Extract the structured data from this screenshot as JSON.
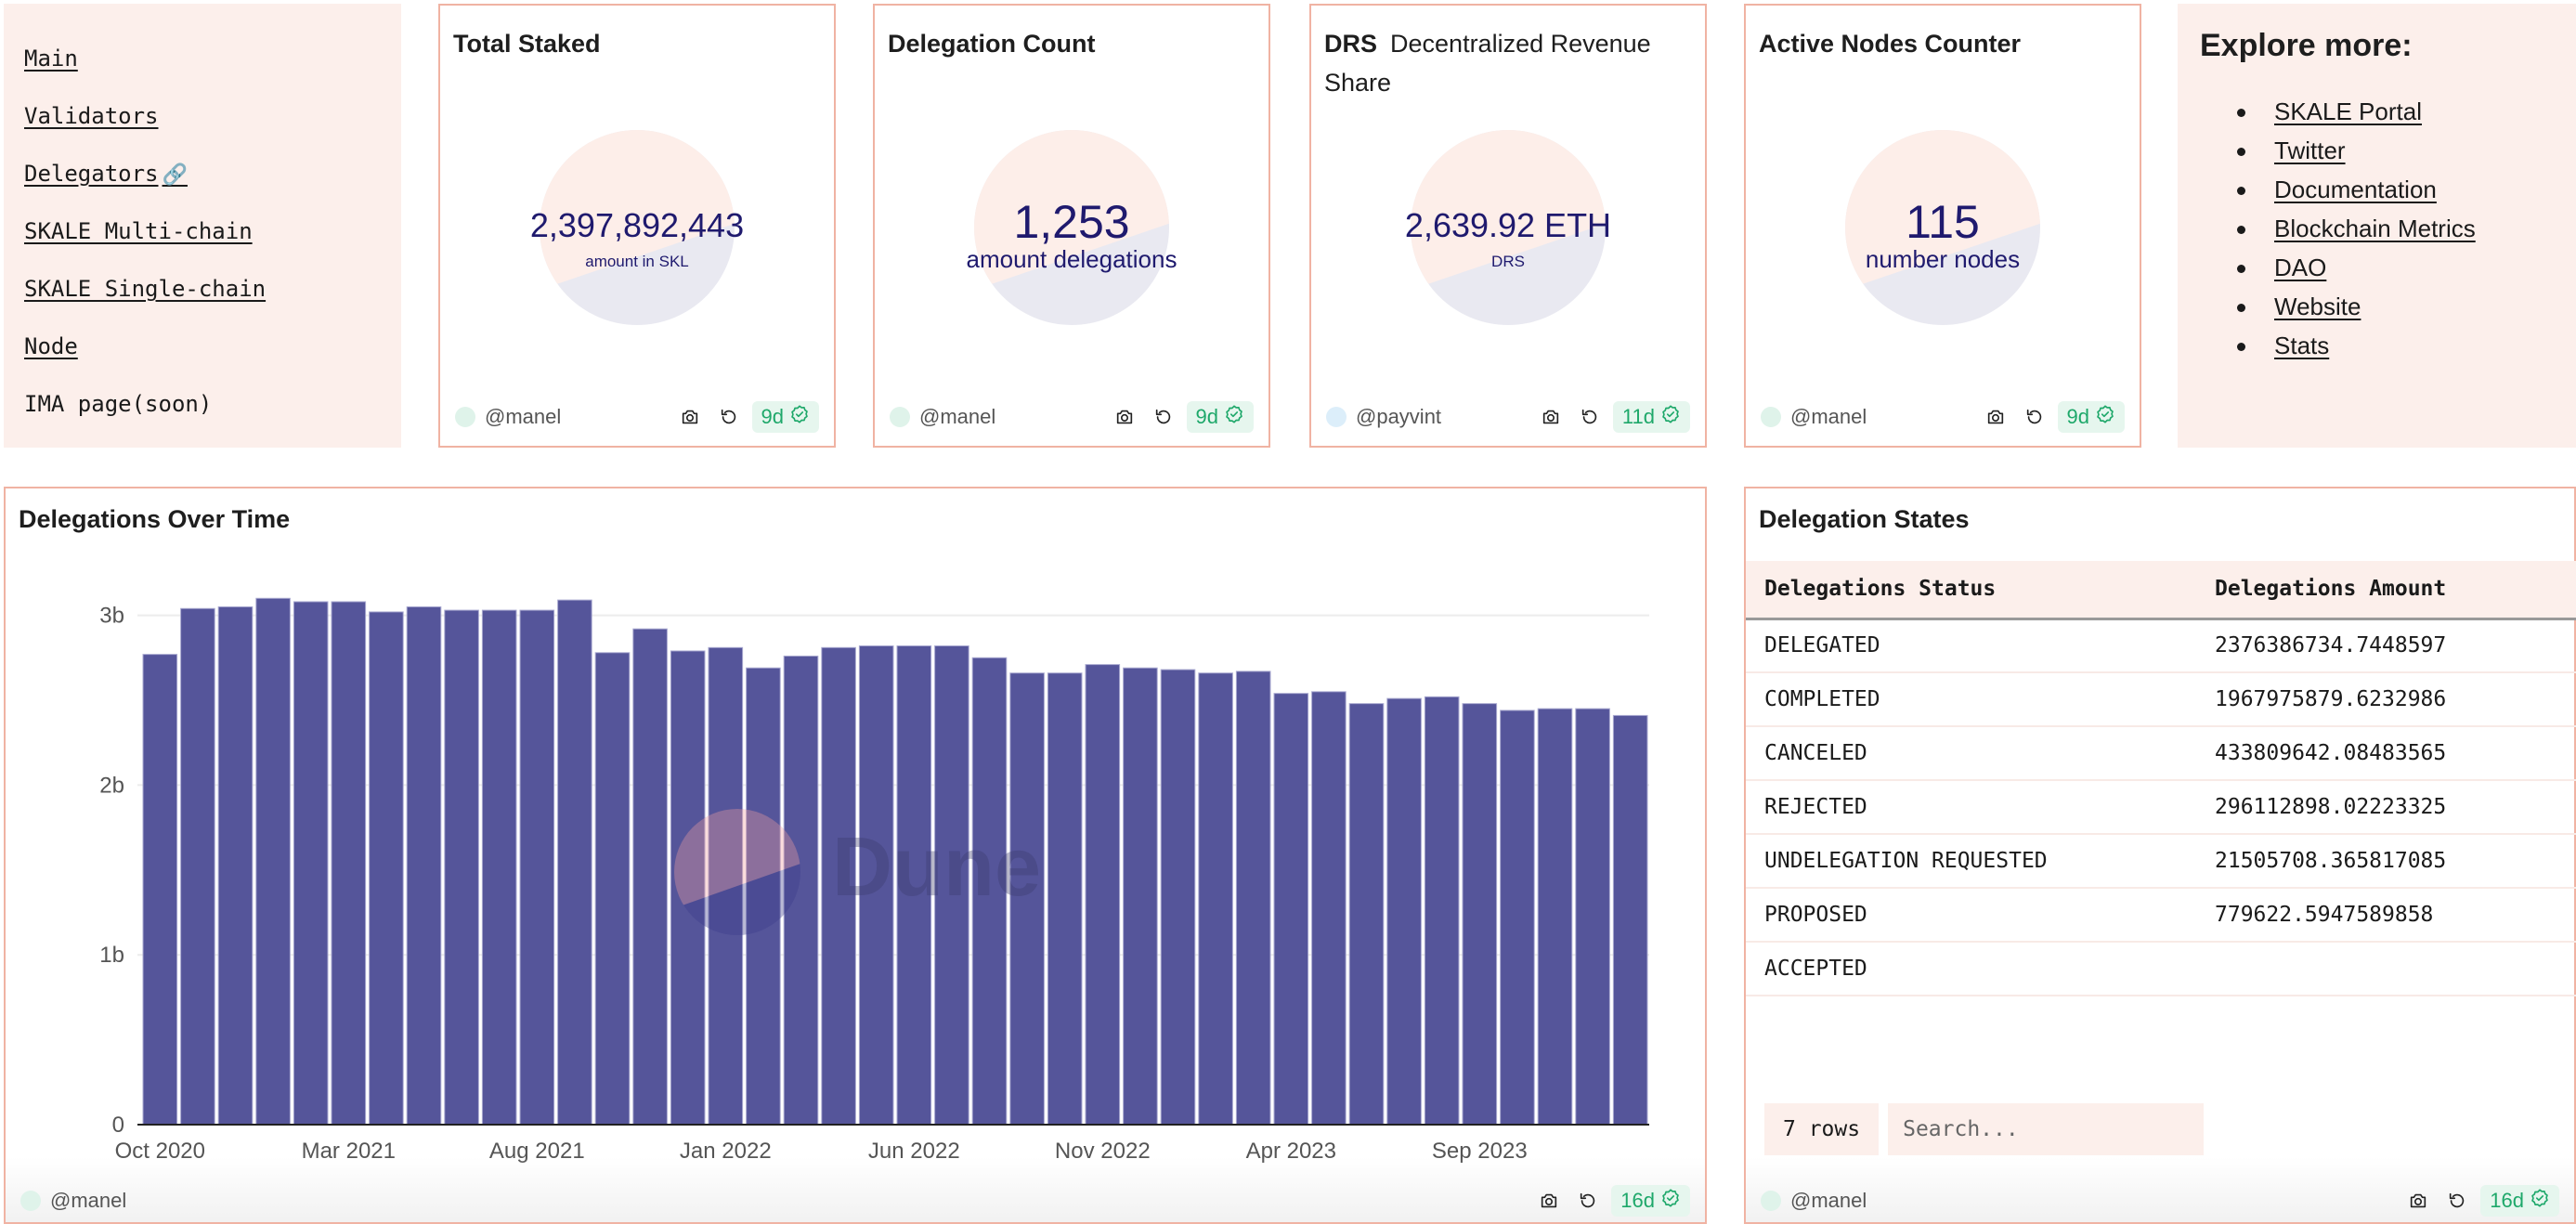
{
  "nav": {
    "items": [
      {
        "label": "Main",
        "link": true
      },
      {
        "label": "Validators",
        "link": true
      },
      {
        "label": "Delegators",
        "link": true,
        "emoji": "🔗"
      },
      {
        "label": "SKALE Multi-chain",
        "link": true
      },
      {
        "label": "SKALE Single-chain",
        "link": true
      },
      {
        "label": "Node",
        "link": true
      },
      {
        "label": "IMA page(soon)",
        "link": false
      }
    ]
  },
  "counters": [
    {
      "title": "Total Staked",
      "subtitle": "",
      "value": "2,397,892,443",
      "label": "amount in SKL",
      "author": "@manel",
      "age": "9d"
    },
    {
      "title": "Delegation Count",
      "subtitle": "",
      "value": "1,253",
      "label": "amount delegations",
      "author": "@manel",
      "age": "9d"
    },
    {
      "title": "DRS",
      "subtitle": "Decentralized Revenue Share",
      "value": "2,639.92 ETH",
      "label": "DRS",
      "author": "@payvint",
      "age": "11d"
    },
    {
      "title": "Active Nodes Counter",
      "subtitle": "",
      "value": "115",
      "label": "number nodes",
      "author": "@manel",
      "age": "9d"
    }
  ],
  "explore": {
    "heading": "Explore more:",
    "links": [
      "SKALE Portal",
      "Twitter",
      "Documentation",
      "Blockchain Metrics",
      "DAO",
      "Website",
      "Stats"
    ]
  },
  "chart_card": {
    "author": "@manel",
    "age": "16d",
    "watermark": "Dune"
  },
  "chart_data": {
    "type": "bar",
    "title": "Delegations Over Time",
    "xlabel": "",
    "ylabel": "",
    "ylim": [
      0,
      3200000000
    ],
    "yticks": [
      0,
      1000000000,
      2000000000,
      3000000000
    ],
    "ytick_labels": [
      "0",
      "1b",
      "2b",
      "3b"
    ],
    "grid": true,
    "legend": "none",
    "color": "#55559a",
    "categories": [
      "Oct 2020",
      "Nov 2020",
      "Dec 2020",
      "Jan 2021",
      "Feb 2021",
      "Mar 2021",
      "Apr 2021",
      "May 2021",
      "Jun 2021",
      "Jul 2021",
      "Aug 2021",
      "Sep 2021",
      "Oct 2021",
      "Nov 2021",
      "Dec 2021",
      "Jan 2022",
      "Feb 2022",
      "Mar 2022",
      "Apr 2022",
      "May 2022",
      "Jun 2022",
      "Jul 2022",
      "Aug 2022",
      "Sep 2022",
      "Oct 2022",
      "Nov 2022",
      "Dec 2022",
      "Jan 2023",
      "Feb 2023",
      "Mar 2023",
      "Apr 2023",
      "May 2023",
      "Jun 2023",
      "Jul 2023",
      "Aug 2023",
      "Sep 2023",
      "Oct 2023",
      "Nov 2023",
      "Dec 2023",
      "Jan 2024"
    ],
    "xtick_labels": [
      "Oct 2020",
      "Mar 2021",
      "Aug 2021",
      "Jan 2022",
      "Jun 2022",
      "Nov 2022",
      "Apr 2023",
      "Sep 2023"
    ],
    "values": [
      2770000000,
      3040000000,
      3050000000,
      3100000000,
      3080000000,
      3080000000,
      3020000000,
      3050000000,
      3030000000,
      3030000000,
      3030000000,
      3090000000,
      2780000000,
      2920000000,
      2790000000,
      2810000000,
      2690000000,
      2760000000,
      2810000000,
      2820000000,
      2820000000,
      2820000000,
      2750000000,
      2660000000,
      2660000000,
      2710000000,
      2690000000,
      2680000000,
      2660000000,
      2670000000,
      2540000000,
      2550000000,
      2480000000,
      2510000000,
      2520000000,
      2480000000,
      2440000000,
      2450000000,
      2450000000,
      2410000000
    ]
  },
  "table": {
    "title": "Delegation States",
    "columns": [
      "Delegations Status",
      "Delegations Amount"
    ],
    "rows": [
      [
        "DELEGATED",
        "2376386734.7448597"
      ],
      [
        "COMPLETED",
        "1967975879.6232986"
      ],
      [
        "CANCELED",
        "433809642.08483565"
      ],
      [
        "REJECTED",
        "296112898.02223325"
      ],
      [
        "UNDELEGATION REQUESTED",
        "21505708.365817085"
      ],
      [
        "PROPOSED",
        "779622.5947589858"
      ],
      [
        "ACCEPTED",
        ""
      ]
    ],
    "row_count": "7 rows",
    "search_placeholder": "Search...",
    "author": "@manel",
    "age": "16d"
  },
  "colors": {
    "accent_border": "#f0b3a3",
    "panel_bg": "#fcefeb",
    "bar": "#55559a",
    "counter_text": "#1f1a6e",
    "fresh_green": "#1ea86a"
  }
}
